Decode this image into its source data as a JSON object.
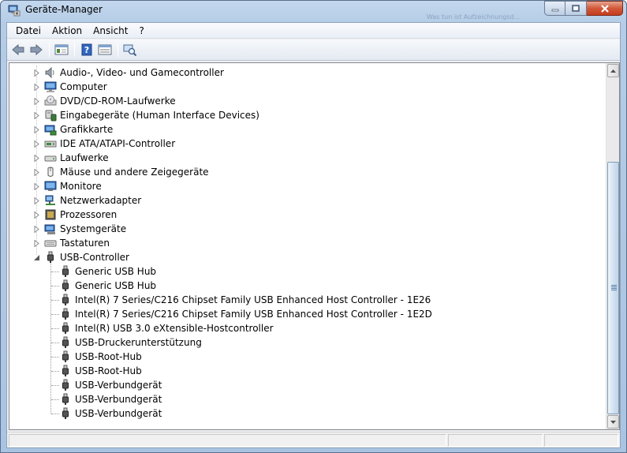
{
  "window": {
    "title": "Geräte-Manager",
    "ghost_text": "Was tun ist Aufzeichnungsd..."
  },
  "menu": [
    "Datei",
    "Aktion",
    "Ansicht",
    "?"
  ],
  "toolbar": {
    "icons": [
      "back-arrow-icon",
      "forward-arrow-icon",
      "show-hide-console-tree-icon",
      "help-icon",
      "properties-icon",
      "scan-hardware-icon"
    ]
  },
  "tree": {
    "categories": [
      {
        "label": "Audio-, Video- und Gamecontroller",
        "icon": "speaker-icon",
        "expanded": false
      },
      {
        "label": "Computer",
        "icon": "computer-icon",
        "expanded": false
      },
      {
        "label": "DVD/CD-ROM-Laufwerke",
        "icon": "dvd-drive-icon",
        "expanded": false
      },
      {
        "label": "Eingabegeräte (Human Interface Devices)",
        "icon": "hid-icon",
        "expanded": false
      },
      {
        "label": "Grafikkarte",
        "icon": "display-adapter-icon",
        "expanded": false
      },
      {
        "label": "IDE ATA/ATAPI-Controller",
        "icon": "ide-controller-icon",
        "expanded": false
      },
      {
        "label": "Laufwerke",
        "icon": "disk-drive-icon",
        "expanded": false
      },
      {
        "label": "Mäuse und andere Zeigegeräte",
        "icon": "mouse-icon",
        "expanded": false
      },
      {
        "label": "Monitore",
        "icon": "monitor-icon",
        "expanded": false
      },
      {
        "label": "Netzwerkadapter",
        "icon": "network-adapter-icon",
        "expanded": false
      },
      {
        "label": "Prozessoren",
        "icon": "processor-icon",
        "expanded": false
      },
      {
        "label": "Systemgeräte",
        "icon": "system-devices-icon",
        "expanded": false
      },
      {
        "label": "Tastaturen",
        "icon": "keyboard-icon",
        "expanded": false
      },
      {
        "label": "USB-Controller",
        "icon": "usb-icon",
        "expanded": true
      }
    ],
    "usb_children": [
      "Generic USB Hub",
      "Generic USB Hub",
      "Intel(R) 7 Series/C216 Chipset Family USB Enhanced Host Controller - 1E26",
      "Intel(R) 7 Series/C216 Chipset Family USB Enhanced Host Controller - 1E2D",
      "Intel(R) USB 3.0 eXtensible-Hostcontroller",
      "USB-Druckerunterstützung",
      "USB-Root-Hub",
      "USB-Root-Hub",
      "USB-Verbundgerät",
      "USB-Verbundgerät",
      "USB-Verbundgerät"
    ]
  },
  "colors": {
    "title_gradient_top": "#c3d8ee",
    "close_button": "#c43d1d",
    "scroll_thumb": "#cfdff0"
  }
}
